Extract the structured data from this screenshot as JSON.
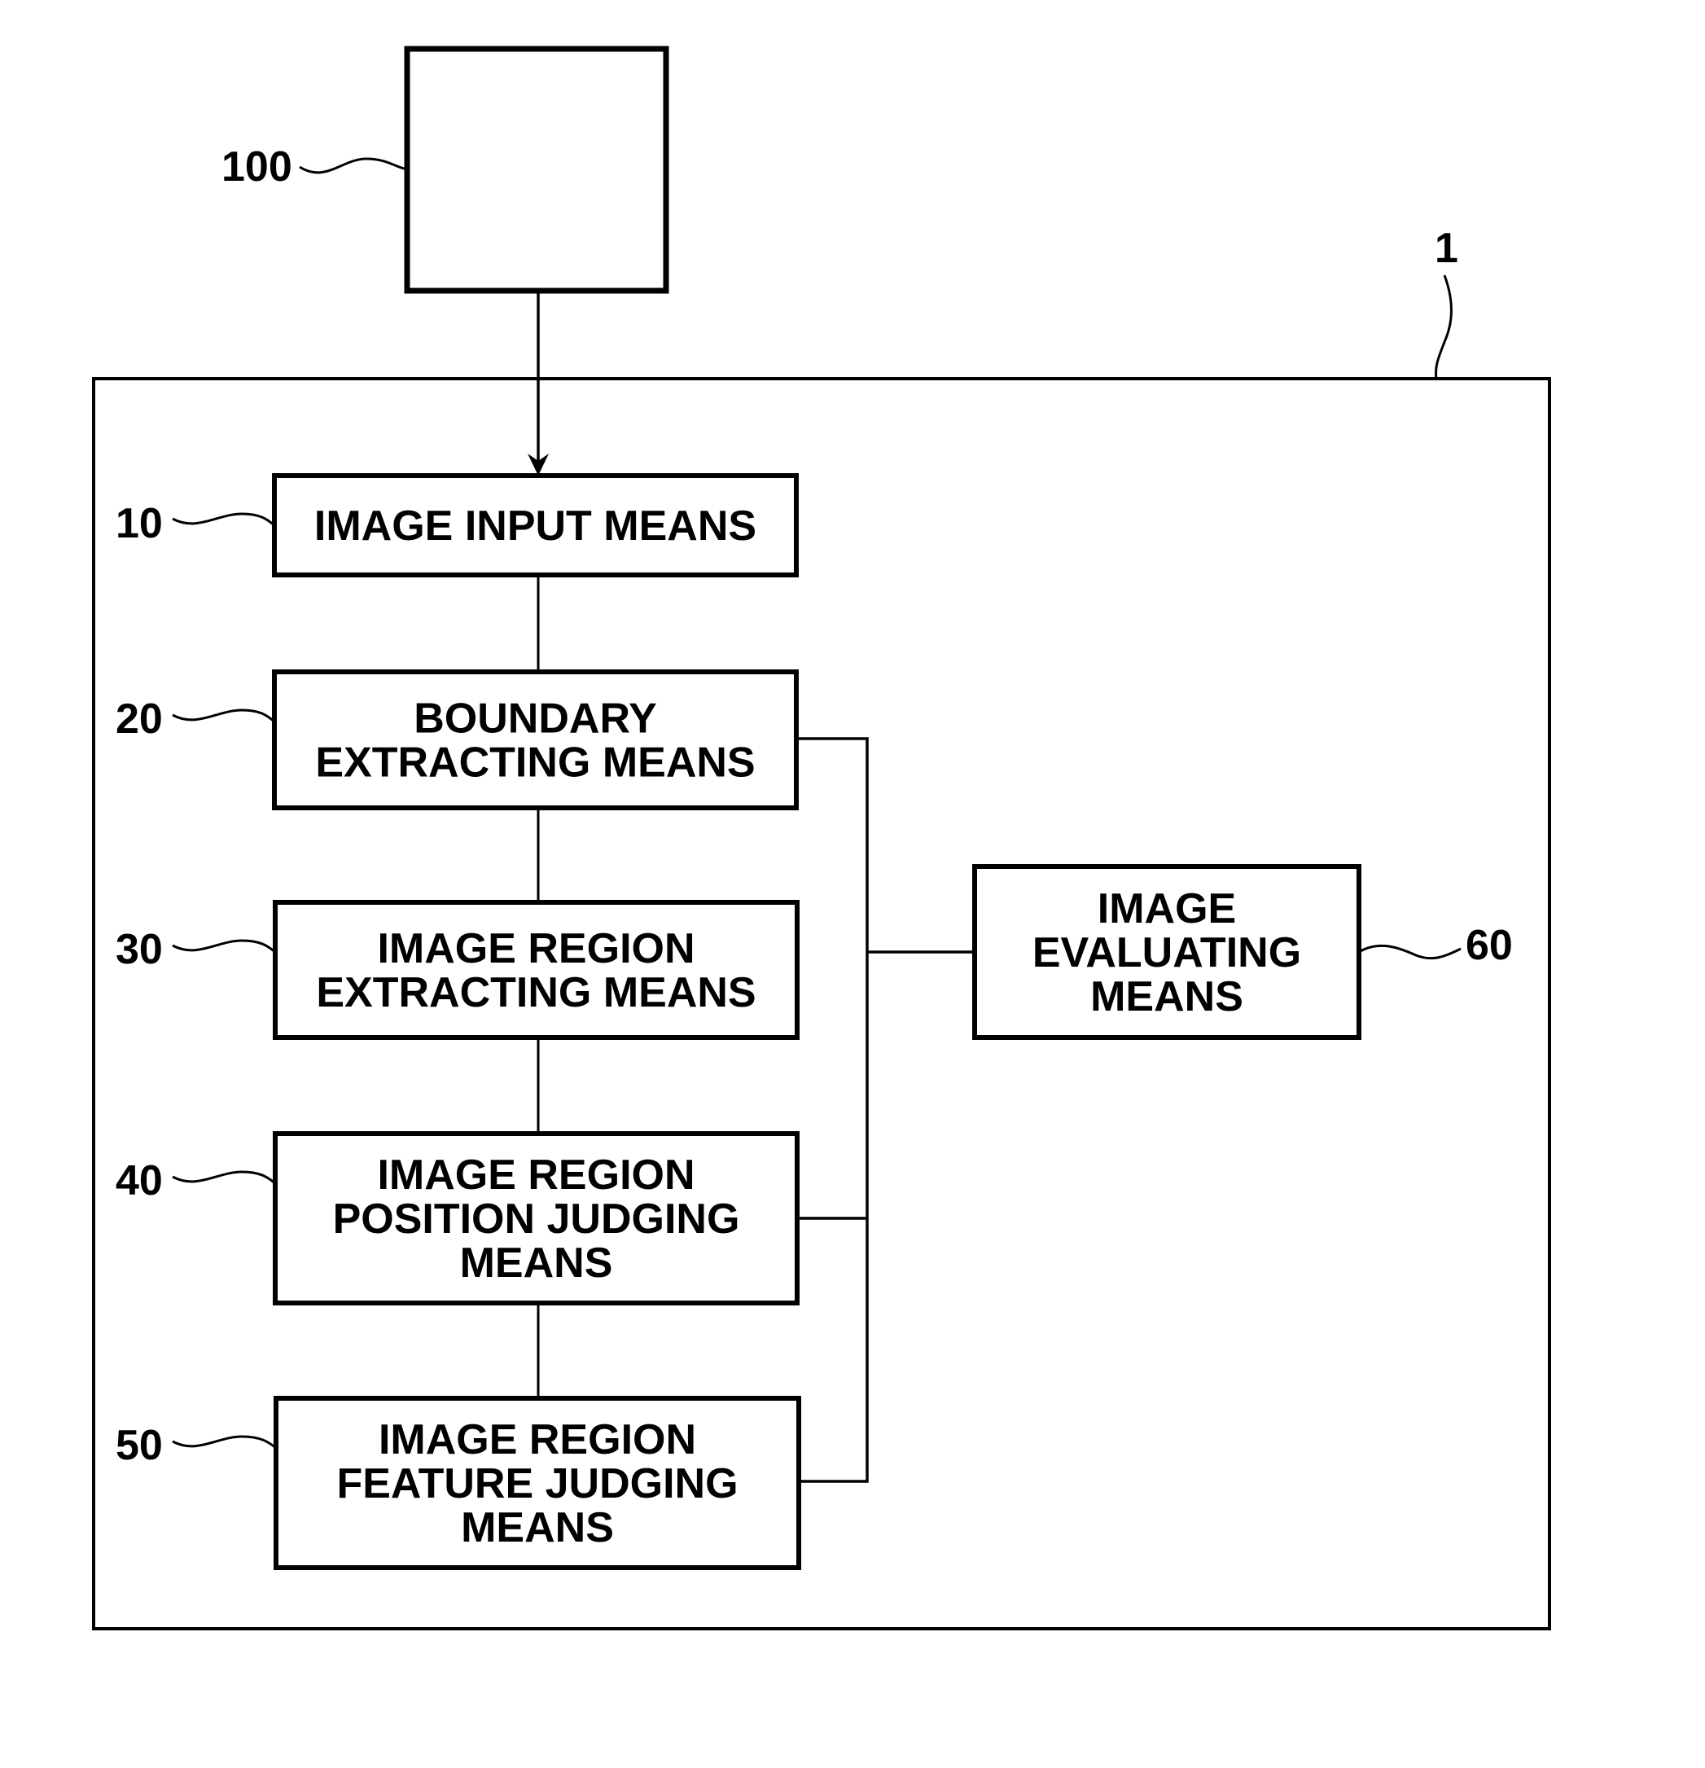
{
  "figure": {
    "external_device": {
      "ref": "100",
      "label": ""
    },
    "system": {
      "ref": "1"
    },
    "blocks": [
      {
        "id": "image-input",
        "ref": "10",
        "lines": [
          "IMAGE INPUT MEANS"
        ]
      },
      {
        "id": "boundary-extracting",
        "ref": "20",
        "lines": [
          "BOUNDARY",
          "EXTRACTING MEANS"
        ]
      },
      {
        "id": "image-region-extracting",
        "ref": "30",
        "lines": [
          "IMAGE REGION",
          "EXTRACTING MEANS"
        ]
      },
      {
        "id": "image-region-position-judging",
        "ref": "40",
        "lines": [
          "IMAGE REGION",
          "POSITION JUDGING",
          "MEANS"
        ]
      },
      {
        "id": "image-region-feature-judging",
        "ref": "50",
        "lines": [
          "IMAGE REGION",
          "FEATURE JUDGING",
          "MEANS"
        ]
      },
      {
        "id": "image-evaluating",
        "ref": "60",
        "lines": [
          "IMAGE",
          "EVALUATING",
          "MEANS"
        ]
      }
    ]
  }
}
